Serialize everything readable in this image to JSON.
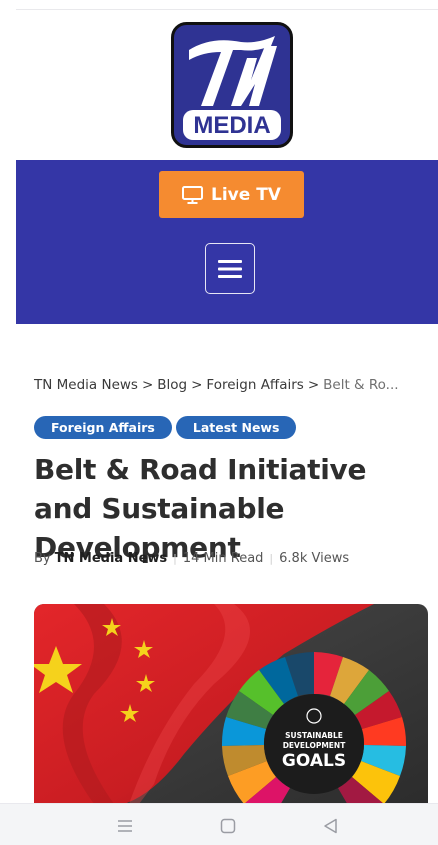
{
  "logo": {
    "line1": "TN",
    "line2": "MEDIA"
  },
  "nav": {
    "live_tv_label": "Live TV",
    "live_tv_icon": "monitor-icon",
    "menu_icon": "hamburger-menu-icon"
  },
  "breadcrumb": {
    "items": [
      "TN Media News",
      "Blog",
      "Foreign Affairs"
    ],
    "separator": ">",
    "current": "Belt & Ro..."
  },
  "tags": [
    "Foreign Affairs",
    "Latest News"
  ],
  "article": {
    "title": "Belt & Road Initiative and Sustainable Development",
    "by_label": "By",
    "author": "TN Media News",
    "read_time": "14 Min Read",
    "views": "6.8k Views"
  },
  "hero_image": {
    "sdg_line1": "SUSTAINABLE",
    "sdg_line2": "DEVELOPMENT",
    "sdg_line3": "GOALS"
  },
  "system_nav": {
    "recents_icon": "recents-icon",
    "home_icon": "home-icon",
    "back_icon": "back-icon"
  },
  "colors": {
    "nav_band": "#3436a6",
    "live_tv_button": "#f58b30",
    "tag": "#2866b6",
    "logo_blue": "#2f3393"
  }
}
